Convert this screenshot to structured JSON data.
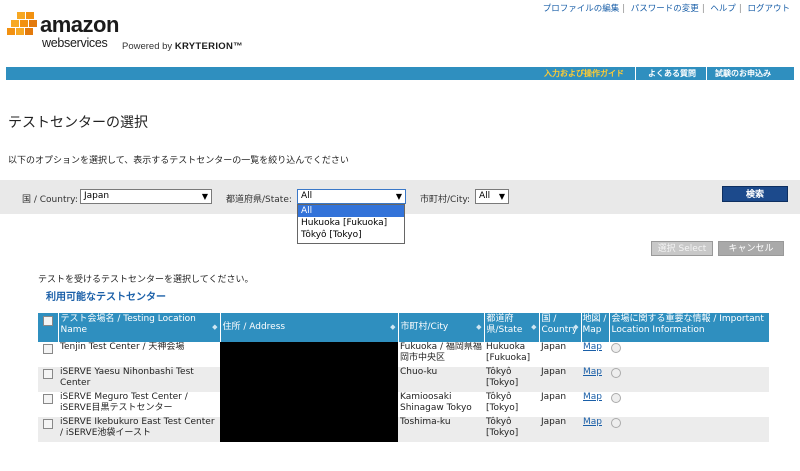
{
  "top_links": [
    "プロファイルの編集",
    "パスワードの変更",
    "ヘルプ",
    "ログアウト"
  ],
  "logo": {
    "word": "amazon",
    "sub": "webservices",
    "powered_by": "Powered by",
    "brand": "KRYTERION™"
  },
  "nav": {
    "guide": "入力および操作ガイド",
    "faq": "よくある質問",
    "apply": "試験のお申込み"
  },
  "page_title": "テストセンターの選択",
  "instruction": "以下のオプションを選択して、表示するテストセンターの一覧を絞り込んでください",
  "filters": {
    "country_label": "国 / Country:",
    "country_value": "Japan",
    "state_label": "都道府県/State:",
    "state_value": "All",
    "city_label": "市町村/City:",
    "city_value": "All",
    "search_label": "検索",
    "state_options": [
      "All",
      "Hukuoka [Fukuoka]",
      "Tôkyô [Tokyo]"
    ]
  },
  "buttons": {
    "select": "選択 Select",
    "cancel": "キャンセル"
  },
  "choose_text": "テストを受けるテストセンターを選択してください。",
  "available_title": "利用可能なテストセンター",
  "table": {
    "headers": [
      "テスト会場名 / Testing Location Name",
      "住所 / Address",
      "市町村/City",
      "都道府県/State",
      "国 / Country",
      "地図 / Map",
      "会場に関する重要な情報 / Important Location Information"
    ],
    "rows": [
      {
        "name": "Tenjin Test Center / 天神会場",
        "city": "Fukuoka / 福岡県福岡市中央区",
        "state": "Hukuoka [Fukuoka]",
        "country": "Japan",
        "map": "Map"
      },
      {
        "name": "iSERVE Yaesu Nihonbashi Test Center",
        "city": "Chuo-ku",
        "state": "Tôkyô [Tokyo]",
        "country": "Japan",
        "map": "Map"
      },
      {
        "name": "iSERVE Meguro Test Center / iSERVE目黒テストセンター",
        "city": "Kamioosaki Shinagaw Tokyo",
        "state": "Tôkyô [Tokyo]",
        "country": "Japan",
        "map": "Map"
      },
      {
        "name": "iSERVE Ikebukuro East Test Center / iSERVE池袋イースト",
        "city": "Toshima-ku",
        "state": "Tôkyô [Tokyo]",
        "country": "Japan",
        "map": "Map"
      }
    ]
  },
  "colors": {
    "accent": "#2f8fbf",
    "link": "#1a5fa8",
    "search": "#1c4a8c",
    "nav_highlight": "#ffcc33"
  }
}
